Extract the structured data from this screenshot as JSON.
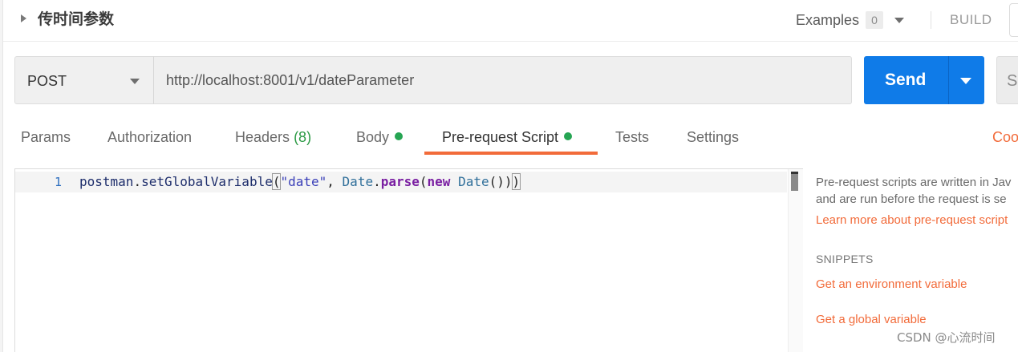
{
  "header": {
    "title": "传时间参数",
    "examples_label": "Examples",
    "examples_count": "0",
    "build_label": "BUILD"
  },
  "request": {
    "method": "POST",
    "url": "http://localhost:8001/v1/dateParameter",
    "send_label": "Send",
    "save_label_partial": "Sa"
  },
  "tabs": [
    {
      "label": "Params"
    },
    {
      "label": "Authorization"
    },
    {
      "label": "Headers",
      "count": "(8)"
    },
    {
      "label": "Body",
      "dot": true
    },
    {
      "label": "Pre-request Script",
      "dot": true,
      "active": true
    },
    {
      "label": "Tests"
    },
    {
      "label": "Settings"
    }
  ],
  "cookies_label_partial": "Coo",
  "editor": {
    "line_number": "1",
    "tokens": {
      "t1": "postman",
      "t2": ".",
      "t3": "setGlobalVariable",
      "t4": "(",
      "t5": "\"date\"",
      "t6": ", ",
      "t7": "Date",
      "t8": ".",
      "t9": "parse",
      "t10": "(",
      "t11": "new",
      "t12": " ",
      "t13": "Date",
      "t14": "()",
      "t15": ")",
      "t16": ")"
    }
  },
  "info": {
    "line1": "Pre-request scripts are written in Jav",
    "line2": "and are run before the request is se",
    "learn_more": "Learn more about pre-request script",
    "snippets_heading": "SNIPPETS",
    "snippets": [
      "Get an environment variable",
      "Get a global variable"
    ]
  },
  "watermark": "CSDN @心流时间",
  "colors": {
    "accent": "#f26b3a",
    "send": "#0f7be8",
    "status_dot": "#26a553"
  }
}
